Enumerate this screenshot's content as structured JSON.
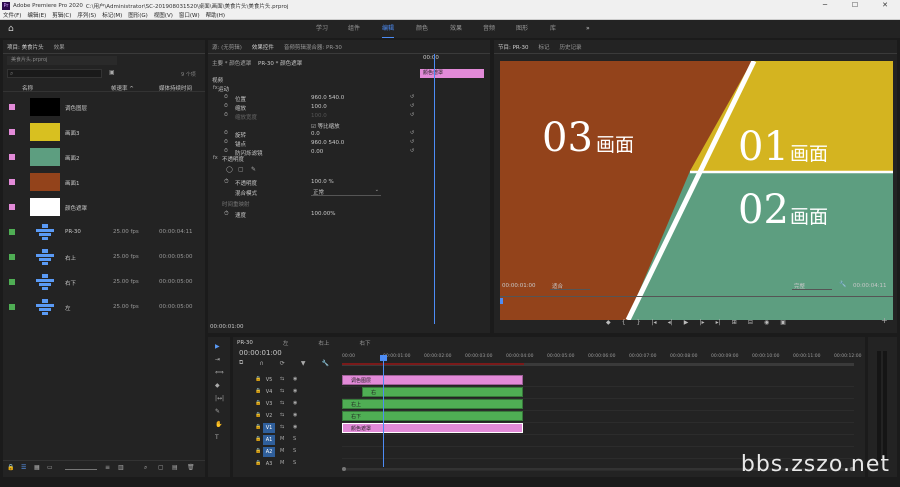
{
  "titlebar": {
    "app": "Adobe Premiere Pro 2020",
    "path": "C:\\用户\\Administrator\\SC-201908031520\\桌面\\画面\\美食片头\\美食片头.prproj",
    "min": "─",
    "max": "☐",
    "close": "✕"
  },
  "menu": [
    "文件(F)",
    "编辑(E)",
    "剪辑(C)",
    "序列(S)",
    "标记(M)",
    "图形(G)",
    "视图(V)",
    "窗口(W)",
    "帮助(H)"
  ],
  "workspaces": {
    "home": "⌂",
    "tabs": [
      "学习",
      "组件",
      "编辑",
      "颜色",
      "效果",
      "音频",
      "图形",
      "库"
    ],
    "active": "编辑",
    "more": "»"
  },
  "project": {
    "tabs": [
      "项目: 美食片头",
      "效果"
    ],
    "file": "美食片头.prproj",
    "count": "9 个项",
    "col_name": "名称",
    "col_fps": "帧速率 ^",
    "col_dur": "媒体持续时间",
    "items": [
      {
        "name": "调色图层",
        "fps": "",
        "dur": "",
        "color": "#e28ad8",
        "thumb": "#000000"
      },
      {
        "name": "画面3",
        "fps": "",
        "dur": "",
        "color": "#e28ad8",
        "thumb": "#d8c020"
      },
      {
        "name": "画面2",
        "fps": "",
        "dur": "",
        "color": "#e28ad8",
        "thumb": "#5d9e80"
      },
      {
        "name": "画面1",
        "fps": "",
        "dur": "",
        "color": "#e28ad8",
        "thumb": "#93431b"
      },
      {
        "name": "颜色遮罩",
        "fps": "",
        "dur": "",
        "color": "#e28ad8",
        "thumb": "#ffffff"
      },
      {
        "name": "PR-30",
        "fps": "25.00 fps",
        "dur": "00:00:04:11",
        "color": "#4fae54",
        "thumb": "seq"
      },
      {
        "name": "右上",
        "fps": "25.00 fps",
        "dur": "00:00:05:00",
        "color": "#4fae54",
        "thumb": "seq"
      },
      {
        "name": "右下",
        "fps": "25.00 fps",
        "dur": "00:00:05:00",
        "color": "#4fae54",
        "thumb": "seq"
      },
      {
        "name": "左",
        "fps": "25.00 fps",
        "dur": "00:00:05:00",
        "color": "#4fae54",
        "thumb": "seq"
      }
    ]
  },
  "effects": {
    "tabs": [
      "源: (无剪辑)",
      "效果控件",
      "音频剪辑混合器: PR-30"
    ],
    "header": "主要 * 颜色遮罩",
    "seq": "PR-30 * 颜色遮罩",
    "clip_tag": "颜色遮罩",
    "time": "00:00",
    "video": "视频",
    "motion": "运动",
    "rows": [
      {
        "n": "位置",
        "v": "960.0   540.0"
      },
      {
        "n": "缩放",
        "v": "100.0"
      },
      {
        "n": "缩放宽度",
        "v": "100.0"
      },
      {
        "n": "等比缩放",
        "v": ""
      },
      {
        "n": "旋转",
        "v": "0.0"
      },
      {
        "n": "锚点",
        "v": "960.0   540.0"
      },
      {
        "n": "防闪烁滤镜",
        "v": "0.00"
      }
    ],
    "opacity": "不透明度",
    "op_row": {
      "n": "不透明度",
      "v": "100.0 %"
    },
    "blend": {
      "n": "混合模式",
      "v": "正常"
    },
    "remap": "时间重映射",
    "speed": {
      "n": "速度",
      "v": "100.00%"
    },
    "footer_time": "00:00:01:00"
  },
  "program": {
    "tabs": [
      "节目: PR-30",
      "标记",
      "历史记录"
    ],
    "time": "00:00:01:00",
    "fit": "适合",
    "quality": "完整",
    "dur": "00:00:04:11",
    "frame": {
      "t03": "03",
      "c03": "画面",
      "t01": "01",
      "c01": "画面",
      "t02": "02",
      "c02": "画面"
    }
  },
  "timeline": {
    "tabs": [
      "PR-30",
      "左",
      "右上",
      "右下"
    ],
    "time": "00:00:01:00",
    "ruler": [
      "00:00",
      "00:00:01:00",
      "00:00:02:00",
      "00:00:03:00",
      "00:00:04:00",
      "00:00:05:00",
      "00:00:06:00",
      "00:00:07:00",
      "00:00:08:00",
      "00:00:09:00",
      "00:00:10:00",
      "00:00:11:00",
      "00:00:12:00"
    ],
    "tracks": [
      "V5",
      "V4",
      "V3",
      "V2",
      "V1",
      "A1",
      "A2",
      "A3"
    ],
    "clips": [
      {
        "label": "调色图层",
        "c": "pink"
      },
      {
        "label": "右",
        "c": "green"
      },
      {
        "label": "右上",
        "c": "green"
      },
      {
        "label": "右下",
        "c": "green"
      },
      {
        "label": "颜色遮罩",
        "c": "pink"
      }
    ]
  },
  "watermark": "bbs.zszo.net"
}
